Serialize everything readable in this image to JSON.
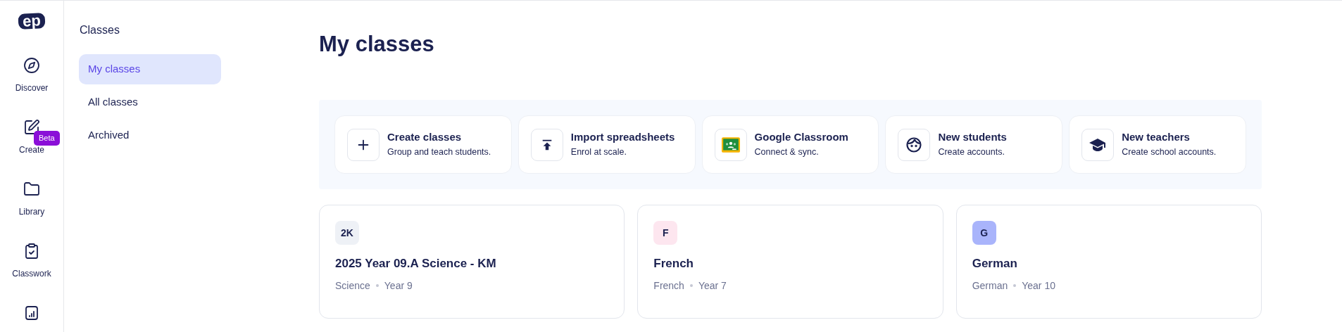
{
  "rail": {
    "logo": "ep",
    "items": [
      {
        "kind": "compass",
        "label": "Discover"
      },
      {
        "kind": "pen",
        "label": "Create",
        "badge": "Beta"
      },
      {
        "kind": "folder",
        "label": "Library"
      },
      {
        "kind": "clipboard",
        "label": "Classwork"
      },
      {
        "kind": "chart"
      }
    ]
  },
  "subnav": {
    "title": "Classes",
    "items": [
      {
        "label": "My classes",
        "selected": true
      },
      {
        "label": "All classes",
        "selected": false
      },
      {
        "label": "Archived",
        "selected": false
      }
    ]
  },
  "page_title": "My classes",
  "actions": [
    {
      "kind": "plus",
      "title": "Create classes",
      "subtitle": "Group and teach students."
    },
    {
      "kind": "upload",
      "title": "Import spreadsheets",
      "subtitle": "Enrol at scale."
    },
    {
      "kind": "classroom",
      "title": "Google Classroom",
      "subtitle": "Connect & sync."
    },
    {
      "kind": "student",
      "title": "New students",
      "subtitle": "Create accounts."
    },
    {
      "kind": "teacher",
      "title": "New teachers",
      "subtitle": "Create school accounts."
    }
  ],
  "classes": [
    {
      "initials": "2K",
      "color": "#eef1f6",
      "name": "2025 Year 09.A Science - KM",
      "subject": "Science",
      "year": "Year 9"
    },
    {
      "initials": "F",
      "color": "#fde6ef",
      "name": "French",
      "subject": "French",
      "year": "Year 7"
    },
    {
      "initials": "G",
      "color": "#a9b4fb",
      "name": "German",
      "subject": "German",
      "year": "Year 10"
    }
  ]
}
